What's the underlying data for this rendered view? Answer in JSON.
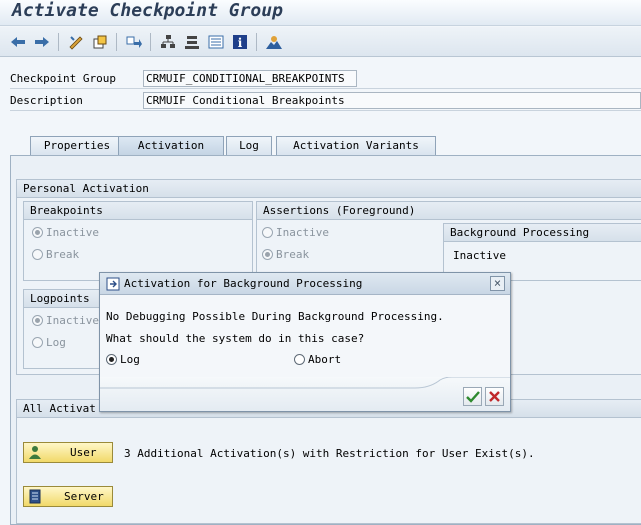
{
  "window": {
    "title": "Activate Checkpoint Group"
  },
  "toolbar": {
    "buttons": [
      {
        "name": "back-icon"
      },
      {
        "name": "forward-icon"
      },
      {
        "name": "edit-pencil-icon"
      },
      {
        "name": "copy-icon"
      },
      {
        "name": "transport-icon"
      },
      {
        "name": "hierarchy-icon"
      },
      {
        "name": "stack-icon"
      },
      {
        "name": "list-icon"
      },
      {
        "name": "info-icon"
      },
      {
        "name": "user-mountain-icon"
      }
    ]
  },
  "header": {
    "checkpoint_group_label": "Checkpoint Group",
    "checkpoint_group_value": "CRMUIF_CONDITIONAL_BREAKPOINTS",
    "description_label": "Description",
    "description_value": "CRMUIF Conditional Breakpoints"
  },
  "tabs": [
    {
      "label": "Properties"
    },
    {
      "label": "Activation",
      "active": true
    },
    {
      "label": "Log"
    },
    {
      "label": "Activation Variants"
    }
  ],
  "personal_activation": {
    "title": "Personal Activation",
    "breakpoints": {
      "title": "Breakpoints",
      "options": [
        "Inactive",
        "Break"
      ],
      "selected": "Inactive"
    },
    "assertions": {
      "title": "Assertions (Foreground)",
      "options": [
        "Inactive",
        "Break"
      ],
      "selected": "Break"
    },
    "background": {
      "title": "Background Processing",
      "value": "Inactive"
    },
    "logpoints": {
      "title": "Logpoints",
      "options": [
        "Inactive",
        "Log"
      ],
      "selected": "Inactive"
    }
  },
  "all_activation": {
    "title": "All Activat",
    "user_button": "User",
    "user_message": "3 Additional Activation(s) with Restriction for User Exist(s).",
    "server_button": "Server"
  },
  "dialog": {
    "title": "Activation for Background Processing",
    "line1": "No Debugging Possible During Background Processing.",
    "line2": "What should the system do in this case?",
    "option_log": "Log",
    "option_abort": "Abort",
    "selected": "Log"
  }
}
